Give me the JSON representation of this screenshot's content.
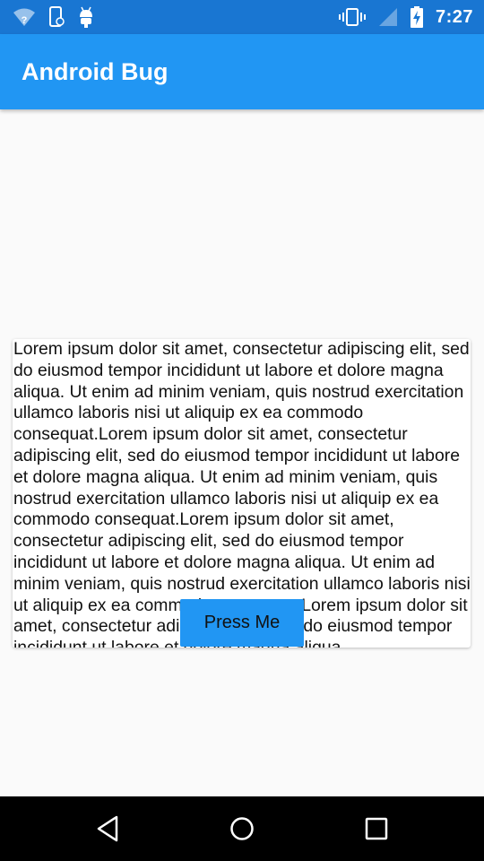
{
  "status_bar": {
    "time": "7:27",
    "left_icons": [
      "wifi-unknown-icon",
      "phone-unknown-icon",
      "android-debug-icon"
    ],
    "right_icons": [
      "vibrate-icon",
      "signal-empty-icon",
      "battery-charging-icon"
    ]
  },
  "app_bar": {
    "title": "Android Bug",
    "color": "#2196f3"
  },
  "main": {
    "body_text": "Lorem ipsum dolor sit amet, consectetur adipiscing elit, sed do eiusmod tempor incididunt ut labore et dolore magna aliqua. Ut enim ad minim veniam, quis nostrud exercitation ullamco laboris nisi ut aliquip ex ea commodo consequat.Lorem ipsum dolor sit amet, consectetur adipiscing elit, sed do eiusmod tempor incididunt ut labore et dolore magna aliqua. Ut enim ad minim veniam, quis nostrud exercitation ullamco laboris nisi ut aliquip ex ea commodo consequat.Lorem ipsum dolor sit amet, consectetur adipiscing elit, sed do eiusmod tempor incididunt ut labore et dolore magna aliqua. Ut enim ad minim veniam, quis nostrud exercitation ullamco laboris nisi ut aliquip ex ea commodo consequat.Lorem ipsum dolor sit amet, consectetur adipiscing elit, sed do eiusmod tempor incididunt ut labore et dolore magna aliqua.",
    "button_label": "Press Me"
  },
  "nav_bar": {
    "buttons": [
      "back-icon",
      "home-icon",
      "recents-icon"
    ]
  }
}
